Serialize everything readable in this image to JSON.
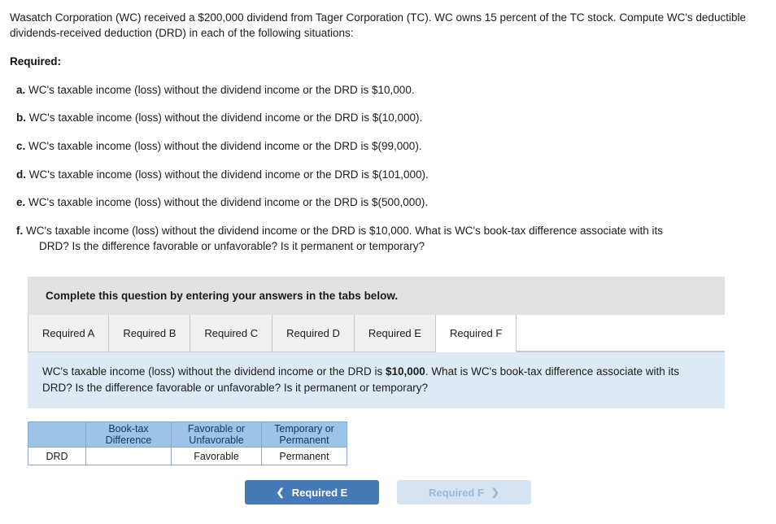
{
  "question": {
    "prompt": "Wasatch Corporation (WC) received a $200,000 dividend from Tager Corporation (TC). WC owns 15 percent of the TC stock. Compute WC's deductible dividends-received deduction (DRD) in each of the following situations:",
    "required_label": "Required:",
    "situations": [
      {
        "letter": "a.",
        "text": "WC's taxable income (loss) without the dividend income or the DRD is $10,000."
      },
      {
        "letter": "b.",
        "text": "WC's taxable income (loss) without the dividend income or the DRD is $(10,000)."
      },
      {
        "letter": "c.",
        "text": "WC's taxable income (loss) without the dividend income or the DRD is $(99,000)."
      },
      {
        "letter": "d.",
        "text": "WC's taxable income (loss) without the dividend income or the DRD is $(101,000)."
      },
      {
        "letter": "e.",
        "text": "WC's taxable income (loss) without the dividend income or the DRD is $(500,000)."
      },
      {
        "letter": "f.",
        "text": "WC's taxable income (loss) without the dividend income or the DRD is $10,000. What is WC's book-tax difference associate with its",
        "text2": "DRD? Is the difference favorable or unfavorable? Is it permanent or temporary?"
      }
    ]
  },
  "panel": {
    "header": "Complete this question by entering your answers in the tabs below.",
    "tabs": [
      {
        "label": "Required A",
        "active": false
      },
      {
        "label": "Required B",
        "active": false
      },
      {
        "label": "Required C",
        "active": false
      },
      {
        "label": "Required D",
        "active": false
      },
      {
        "label": "Required E",
        "active": false
      },
      {
        "label": "Required F",
        "active": true
      }
    ],
    "tab_body": {
      "lead": "WC's taxable income (loss) without the dividend income or the DRD is ",
      "amount": "$10,000",
      "tail": ". What is WC's book-tax difference associate with its DRD? Is the difference favorable or unfavorable? Is it permanent or temporary?"
    }
  },
  "answer_table": {
    "headers": [
      {
        "line1": "",
        "line2": ""
      },
      {
        "line1": "Book-tax",
        "line2": "Difference"
      },
      {
        "line1": "Favorable or",
        "line2": "Unfavorable"
      },
      {
        "line1": "Temporary or",
        "line2": "Permanent"
      }
    ],
    "rows": [
      {
        "label": "DRD",
        "book_tax_difference": "",
        "book_tax_difference_placeholder": "",
        "favorable_or_unfavorable": "Favorable",
        "temporary_or_permanent": "Permanent"
      }
    ]
  },
  "navigation": {
    "prev_label": "Required E",
    "prev_icon": "chevron-left-icon",
    "next_label": "Required F",
    "next_icon": "chevron-right-icon"
  },
  "colors": {
    "tab_body_bg": "#ddeaf6",
    "table_header_bg": "#9dc3e6",
    "prev_button_bg": "#4579b8",
    "next_button_bg": "#d6e3f3",
    "panel_header_bg": "#e2e2e2"
  }
}
